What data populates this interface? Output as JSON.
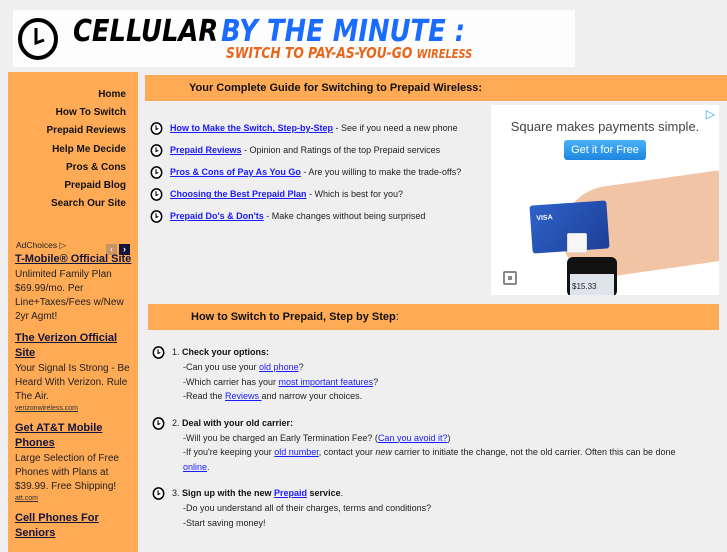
{
  "banner": {
    "word1": "CELLULAR",
    "word2": "BY THE MINUTE :",
    "tagline_main": "SWITCH TO PAY-AS-YOU-GO",
    "tagline_small": "WIRELESS"
  },
  "sidebar": {
    "nav": [
      "Home",
      "How To Switch",
      "Prepaid Reviews",
      "Help Me Decide",
      "Pros & Cons",
      "Prepaid Blog",
      "Search Our Site"
    ],
    "adchoices_label": "AdChoices",
    "ads": [
      {
        "headline": "T-Mobile® Official Site",
        "body": "Unlimited Family Plan $69.99/mo. Per Line+Taxes/Fees w/New 2yr Agmt!",
        "url": ""
      },
      {
        "headline": "The Verizon Official Site",
        "body": "Your Signal Is Strong - Be Heard With Verizon. Rule The Air.",
        "url": "verizonwireless.com"
      },
      {
        "headline": "Get AT&T Mobile Phones",
        "body": "Large Selection of Free Phones with Plans at $39.99. Free Shipping!",
        "url": "att.com"
      },
      {
        "headline": "Cell Phones For Seniors",
        "body": "",
        "url": ""
      }
    ]
  },
  "guide": {
    "header": "Your Complete Guide for Switching to Prepaid Wireless:",
    "items": [
      {
        "link": "How to Make the Switch, Step-by-Step",
        "desc": " - See if you need a new phone"
      },
      {
        "link": "Prepaid Reviews",
        "desc": " - Opinion and Ratings of the top Prepaid services"
      },
      {
        "link": "Pros & Cons of Pay As You Go",
        "desc": " - Are you willing to make the trade-offs?"
      },
      {
        "link": "Choosing the Best Prepaid Plan",
        "desc": " - Which is best for you?"
      },
      {
        "link": "Prepaid Do's & Don'ts",
        "desc": " - Make changes without being surprised"
      }
    ]
  },
  "square_ad": {
    "headline": "Square makes payments simple.",
    "cta": "Get it for Free",
    "card_brand": "VISA",
    "phone_amount": "$15.33"
  },
  "steps": {
    "header": "How to Switch to Prepaid, Step by Step",
    "header_suffix": ":",
    "items": [
      {
        "num": "1.",
        "title": "Check your options:",
        "lines": [
          {
            "pre": "-Can you use your ",
            "link": "old phone",
            "post": "?"
          },
          {
            "pre": "-Which carrier has your ",
            "link": "most important features",
            "post": "?"
          },
          {
            "pre": "-Read the ",
            "link": "Reviews ",
            "post": "and narrow your choices."
          }
        ]
      },
      {
        "num": "2.",
        "title": "Deal with your old carrier:",
        "lines": [
          {
            "pre": "-Will you be charged an Early Termination Fee? (",
            "link": "Can you avoid it?",
            "post": ")"
          },
          {
            "pre": "-If you're keeping your ",
            "link": "old number",
            "post": ", contact your ",
            "em": "new",
            "post2": " carrier to initiate the change, not the old carrier. Often this can be done "
          },
          {
            "pre": "",
            "link": "online",
            "post": "."
          }
        ]
      },
      {
        "num": "3.",
        "title_pre": "Sign up with the new ",
        "title_link": "Prepaid",
        "title_post": " service",
        "title_end": ".",
        "lines": [
          {
            "pre": "-Do you understand all of their charges, terms and conditions?"
          },
          {
            "pre": "-Start saving money!"
          }
        ]
      }
    ]
  }
}
